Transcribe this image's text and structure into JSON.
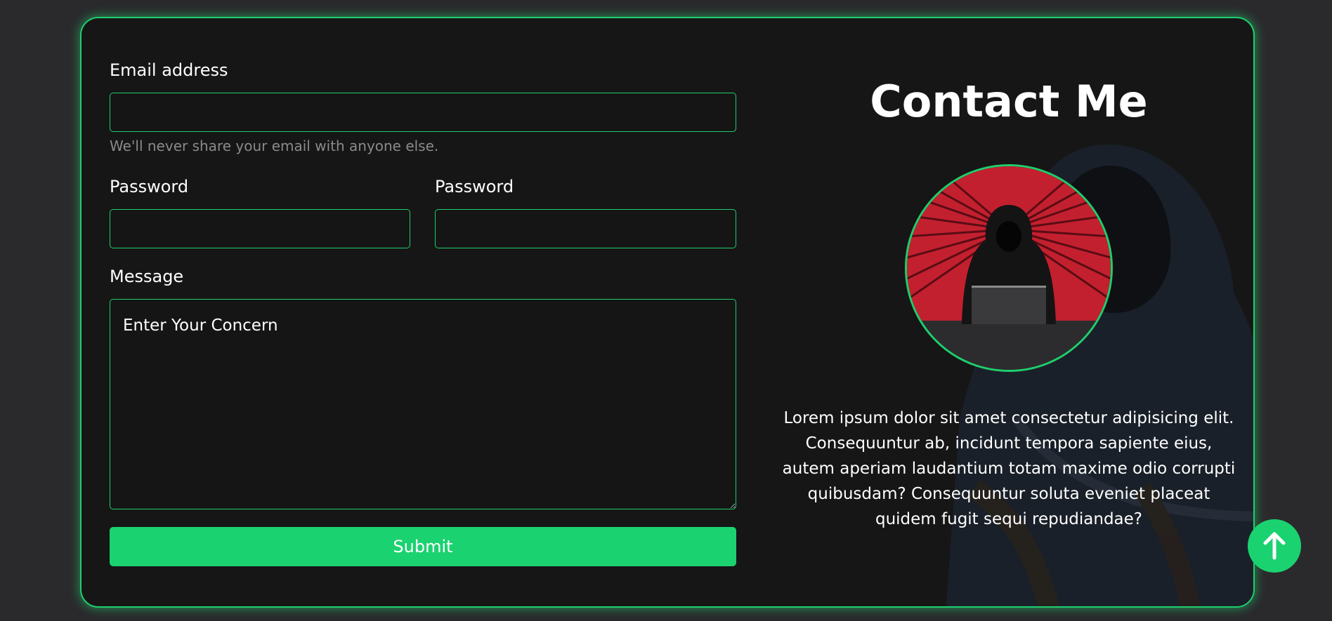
{
  "form": {
    "email_label": "Email address",
    "email_value": "",
    "email_help": "We'll never share your email with anyone else.",
    "password_label_1": "Password",
    "password_value_1": "",
    "password_label_2": "Password",
    "password_value_2": "",
    "message_label": "Message",
    "message_placeholder": "Enter Your Concern",
    "submit_label": "Submit"
  },
  "contact": {
    "title": "Contact Me",
    "bio": "Lorem ipsum dolor sit amet consectetur adipisicing elit. Consequuntur ab, incidunt tempora sapiente eius, autem aperiam laudantium totam maxime odio corrupti quibusdam? Consequuntur soluta eveniet placeat quidem fugit sequi repudiandae?"
  },
  "colors": {
    "accent": "#1fce6d",
    "card_bg": "#161616",
    "page_bg": "#2a2a2c"
  },
  "icons": {
    "scroll_top": "arrow-up-icon"
  }
}
